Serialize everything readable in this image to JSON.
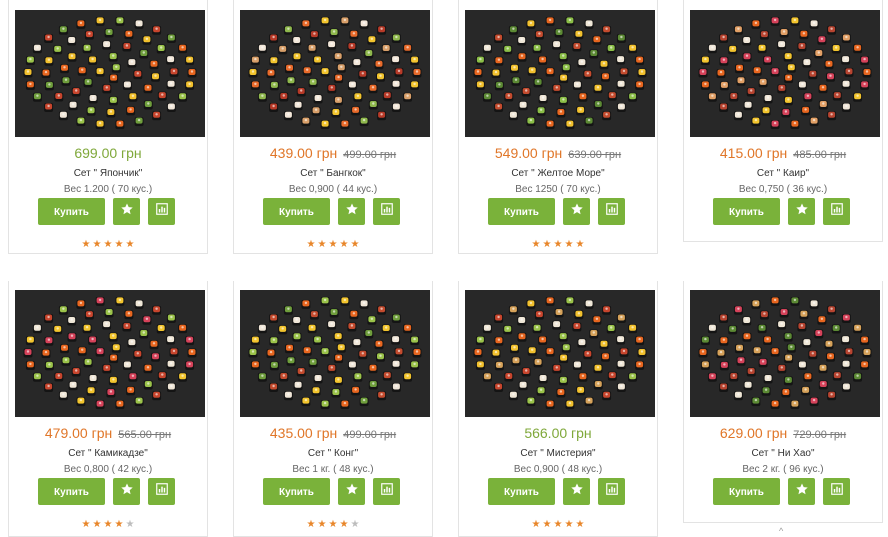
{
  "currency": "грн",
  "labels": {
    "buy": "Купить"
  },
  "colors": {
    "sale_price": "#e07628",
    "regular_price": "#7fa83a",
    "button": "#7ab23a",
    "star_on": "#e8862a",
    "star_off": "#bdbdbd"
  },
  "icons": {
    "favorite": "star-icon",
    "compare": "bar-chart-icon"
  },
  "products": [
    {
      "name": "Сет \" Япончик\"",
      "price": "699.00 грн",
      "old_price": "",
      "weight": "Вес 1.200 ( 70 кус.)",
      "rating": 5,
      "on_sale": false
    },
    {
      "name": "Сет \" Бангкок\"",
      "price": "439.00 грн",
      "old_price": "499.00 грн",
      "weight": "Вес 0,900 ( 44 кус.)",
      "rating": 5,
      "on_sale": true
    },
    {
      "name": "Сет \" Желтое Море\"",
      "price": "549.00 грн",
      "old_price": "639.00 грн",
      "weight": "Вес 1250 ( 70 кус.)",
      "rating": 5,
      "on_sale": true
    },
    {
      "name": "Сет \" Каир\"",
      "price": "415.00 грн",
      "old_price": "485.00 грн",
      "weight": "Вес 0,750 ( 36 кус.)",
      "rating": 0,
      "on_sale": true
    },
    {
      "name": "Сет \" Камикадзе\"",
      "price": "479.00 грн",
      "old_price": "565.00 грн",
      "weight": "Вес 0,800 ( 42 кус.)",
      "rating": 4,
      "on_sale": true
    },
    {
      "name": "Сет \" Конг\"",
      "price": "435.00 грн",
      "old_price": "499.00 грн",
      "weight": "Вес 1 кг. ( 48 кус.)",
      "rating": 4,
      "on_sale": true
    },
    {
      "name": "Сет \" Мистерия\"",
      "price": "566.00 грн",
      "old_price": "",
      "weight": "Вес 0,900 ( 48 кус.)",
      "rating": 5,
      "on_sale": false
    },
    {
      "name": "Сет \" Ни Хао\"",
      "price": "629.00 грн",
      "old_price": "729.00 грн",
      "weight": "Вес 2 кг. ( 96 кус.)",
      "rating": 0,
      "on_sale": true
    }
  ]
}
